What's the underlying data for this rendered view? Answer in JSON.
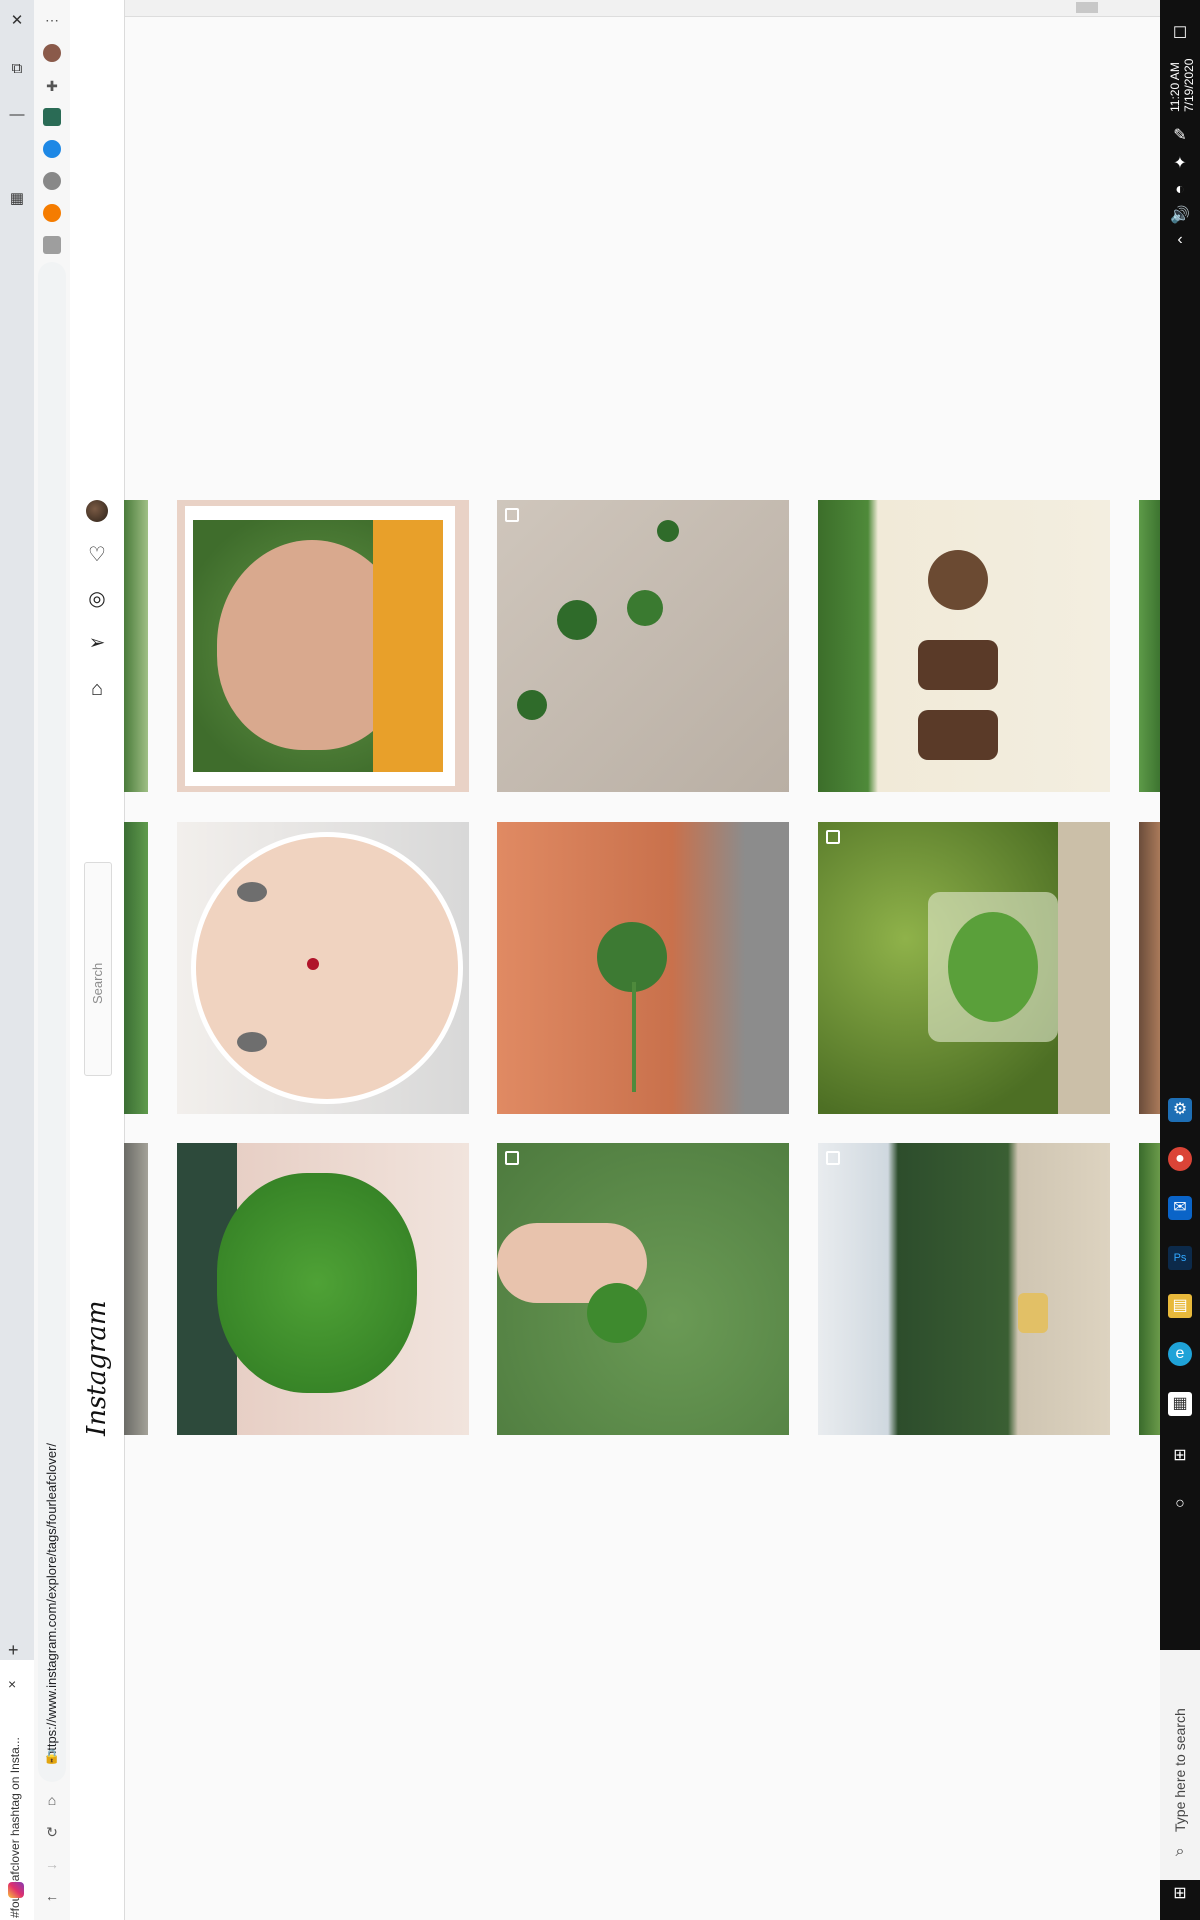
{
  "browser": {
    "tab_title": "#fourleafclover hashtag on Insta...",
    "url": "https://www.instagram.com/explore/tags/fourleafclover/",
    "new_tab_symbol": "+",
    "close_symbol": "×"
  },
  "instagram": {
    "logo": "Instagram",
    "search_placeholder": "Search"
  },
  "taskbar": {
    "time": "11:20 AM",
    "date": "7/19/2020",
    "search_placeholder": "Type here to search"
  },
  "grid": {
    "rows": [
      [
        "cartoon face portrait on clover",
        "three-leaf clovers on wood",
        "clover charm jewelry"
      ],
      [
        "painted face with ladybug",
        "clover in open hand",
        "clover in resin pendant"
      ],
      [
        "four-leaf clover close-up",
        "four-leaf clover held in fingers",
        "people searching a field"
      ]
    ]
  },
  "colors": {
    "accent_green": "#3f8f2f",
    "taskbar": "#101010",
    "ig_border": "#dbdbdb"
  }
}
